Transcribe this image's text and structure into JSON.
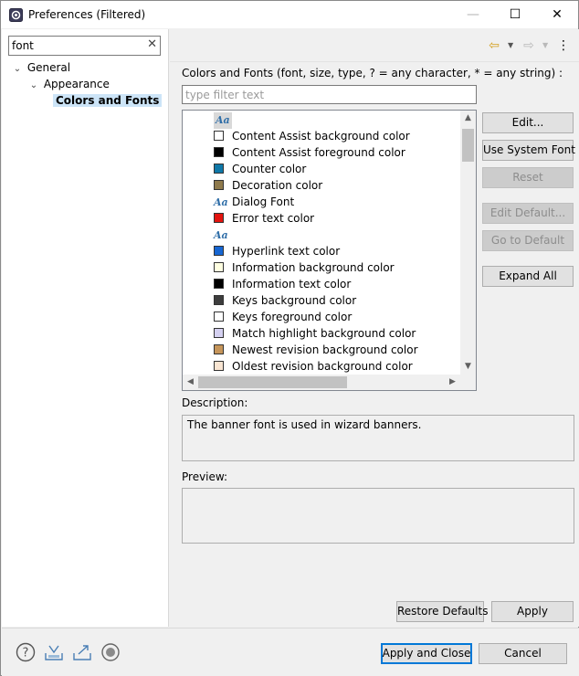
{
  "window": {
    "title": "Preferences (Filtered)",
    "controls": {
      "minimize": "—",
      "maximize": "☐",
      "close": "✕"
    }
  },
  "sidebar": {
    "search": {
      "value": "font",
      "clear_icon": "✕"
    },
    "tree": [
      {
        "label": "General",
        "level": 0,
        "expanded": true
      },
      {
        "label": "Appearance",
        "level": 1,
        "expanded": true
      },
      {
        "label": "Colors and Fonts",
        "level": 2,
        "selected": true
      }
    ]
  },
  "toolbar": {
    "back_icon": "⇦",
    "forward_icon": "⇨",
    "menu_icon": "⋮"
  },
  "main": {
    "list_label": "Colors and Fonts (font, size, type, ? = any character, * = any string) :",
    "filter_placeholder": "type filter text",
    "items": [
      {
        "kind": "font",
        "label": "",
        "selected": true
      },
      {
        "kind": "color",
        "label": "Content Assist background color",
        "color": "#ffffff"
      },
      {
        "kind": "color",
        "label": "Content Assist foreground color",
        "color": "#000000"
      },
      {
        "kind": "color",
        "label": "Counter color",
        "color": "#0f78a8"
      },
      {
        "kind": "color",
        "label": "Decoration color",
        "color": "#8f7a4c"
      },
      {
        "kind": "font",
        "label": "Dialog Font"
      },
      {
        "kind": "color",
        "label": "Error text color",
        "color": "#e3140f"
      },
      {
        "kind": "font",
        "label": ""
      },
      {
        "kind": "color",
        "label": "Hyperlink text color",
        "color": "#1666d2"
      },
      {
        "kind": "color",
        "label": "Information background color",
        "color": "#ffffe1"
      },
      {
        "kind": "color",
        "label": "Information text color",
        "color": "#000000"
      },
      {
        "kind": "color",
        "label": "Keys background color",
        "color": "#3d3d3d"
      },
      {
        "kind": "color",
        "label": "Keys foreground color",
        "color": "#ffffff"
      },
      {
        "kind": "color",
        "label": "Match highlight background color",
        "color": "#d4d0f0"
      },
      {
        "kind": "color",
        "label": "Newest revision background color",
        "color": "#c6955a"
      },
      {
        "kind": "color",
        "label": "Oldest revision background color",
        "color": "#f9e5d2"
      }
    ],
    "font_glyph": "Aa",
    "buttons": {
      "edit": "Edit...",
      "use_system_font": "Use System Font",
      "reset": "Reset",
      "edit_default": "Edit Default...",
      "go_to_default": "Go to Default",
      "expand_all": "Expand All"
    },
    "description_label": "Description:",
    "description_text": "The banner font is used in wizard banners.",
    "preview_label": "Preview:",
    "restore_defaults": "Restore Defaults",
    "apply": "Apply"
  },
  "footer": {
    "apply_and_close": "Apply and Close",
    "cancel": "Cancel",
    "icons": [
      "help-icon",
      "import-icon",
      "export-icon",
      "record-icon"
    ]
  }
}
